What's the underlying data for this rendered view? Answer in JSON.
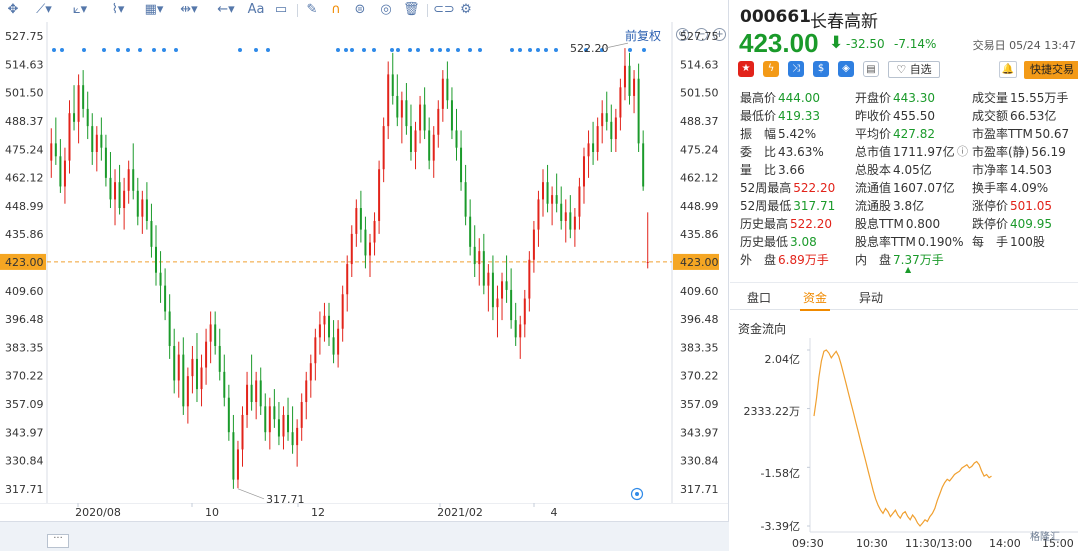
{
  "toolbar": {
    "text_tool": "Aa",
    "restore_label": "前复权"
  },
  "colors": {
    "up": "#e2231a",
    "down": "#1a9a2a",
    "price_line": "#f0a030",
    "flow_line": "#f0a030",
    "accent": "#f08a00",
    "axis_text": "#333333"
  },
  "chart_data": {
    "type": "candlestick",
    "y_ticks": [
      "527.75",
      "514.63",
      "501.50",
      "488.37",
      "475.24",
      "462.12",
      "448.99",
      "435.86",
      "423.00",
      "409.60",
      "396.48",
      "383.35",
      "370.22",
      "357.09",
      "343.97",
      "330.84",
      "317.71"
    ],
    "ylim": [
      311.15,
      534.31
    ],
    "current_price": 423.0,
    "current_price_label": "423.00",
    "high_label": "522.20",
    "low_label": "317.71",
    "x_ticks": [
      "2020/08",
      "10",
      "12",
      "2021/02",
      "4"
    ],
    "candles": [
      [
        470,
        485,
        462,
        478
      ],
      [
        478,
        490,
        468,
        472
      ],
      [
        472,
        480,
        455,
        458
      ],
      [
        458,
        476,
        450,
        470
      ],
      [
        470,
        498,
        464,
        492
      ],
      [
        492,
        505,
        484,
        488
      ],
      [
        488,
        510,
        478,
        505
      ],
      [
        505,
        512,
        490,
        494
      ],
      [
        494,
        502,
        480,
        486
      ],
      [
        486,
        492,
        468,
        474
      ],
      [
        474,
        486,
        465,
        482
      ],
      [
        482,
        490,
        470,
        476
      ],
      [
        476,
        482,
        458,
        462
      ],
      [
        462,
        474,
        448,
        452
      ],
      [
        452,
        466,
        440,
        460
      ],
      [
        460,
        468,
        445,
        448
      ],
      [
        448,
        462,
        438,
        456
      ],
      [
        456,
        470,
        450,
        466
      ],
      [
        466,
        478,
        452,
        456
      ],
      [
        456,
        462,
        440,
        444
      ],
      [
        444,
        456,
        436,
        452
      ],
      [
        452,
        460,
        438,
        442
      ],
      [
        442,
        450,
        425,
        430
      ],
      [
        430,
        440,
        412,
        418
      ],
      [
        418,
        428,
        404,
        412
      ],
      [
        412,
        420,
        396,
        400
      ],
      [
        400,
        408,
        378,
        384
      ],
      [
        384,
        392,
        362,
        368
      ],
      [
        368,
        386,
        360,
        380
      ],
      [
        380,
        388,
        352,
        356
      ],
      [
        356,
        374,
        348,
        370
      ],
      [
        370,
        384,
        362,
        378
      ],
      [
        378,
        390,
        358,
        364
      ],
      [
        364,
        380,
        356,
        374
      ],
      [
        374,
        392,
        366,
        386
      ],
      [
        386,
        400,
        376,
        394
      ],
      [
        394,
        400,
        380,
        384
      ],
      [
        384,
        392,
        368,
        372
      ],
      [
        372,
        380,
        356,
        360
      ],
      [
        360,
        366,
        340,
        344
      ],
      [
        344,
        352,
        317.71,
        322
      ],
      [
        322,
        340,
        318,
        336
      ],
      [
        336,
        356,
        328,
        352
      ],
      [
        352,
        372,
        346,
        366
      ],
      [
        366,
        380,
        354,
        358
      ],
      [
        358,
        372,
        350,
        368
      ],
      [
        368,
        374,
        352,
        356
      ],
      [
        356,
        362,
        340,
        344
      ],
      [
        344,
        360,
        336,
        356
      ],
      [
        356,
        364,
        346,
        350
      ],
      [
        350,
        358,
        338,
        342
      ],
      [
        342,
        356,
        336,
        352
      ],
      [
        352,
        360,
        340,
        344
      ],
      [
        344,
        356,
        334,
        338
      ],
      [
        338,
        350,
        328,
        346
      ],
      [
        346,
        362,
        340,
        358
      ],
      [
        358,
        372,
        350,
        368
      ],
      [
        368,
        380,
        360,
        376
      ],
      [
        376,
        392,
        368,
        388
      ],
      [
        388,
        400,
        380,
        394
      ],
      [
        394,
        404,
        386,
        398
      ],
      [
        398,
        404,
        384,
        388
      ],
      [
        388,
        396,
        376,
        380
      ],
      [
        380,
        396,
        374,
        392
      ],
      [
        392,
        412,
        386,
        408
      ],
      [
        408,
        426,
        400,
        422
      ],
      [
        422,
        440,
        416,
        436
      ],
      [
        436,
        452,
        430,
        448
      ],
      [
        448,
        456,
        432,
        438
      ],
      [
        438,
        444,
        420,
        426
      ],
      [
        426,
        436,
        416,
        432
      ],
      [
        432,
        446,
        426,
        442
      ],
      [
        442,
        470,
        436,
        466
      ],
      [
        466,
        490,
        460,
        486
      ],
      [
        486,
        516,
        480,
        510
      ],
      [
        510,
        520,
        496,
        500
      ],
      [
        500,
        510,
        486,
        490
      ],
      [
        490,
        502,
        478,
        498
      ],
      [
        498,
        506,
        482,
        486
      ],
      [
        486,
        496,
        470,
        474
      ],
      [
        474,
        488,
        466,
        484
      ],
      [
        484,
        500,
        478,
        496
      ],
      [
        496,
        504,
        480,
        484
      ],
      [
        484,
        490,
        466,
        470
      ],
      [
        470,
        486,
        462,
        482
      ],
      [
        482,
        498,
        476,
        494
      ],
      [
        494,
        512,
        488,
        508
      ],
      [
        508,
        516,
        494,
        498
      ],
      [
        498,
        504,
        480,
        484
      ],
      [
        484,
        494,
        470,
        476
      ],
      [
        476,
        484,
        456,
        460
      ],
      [
        460,
        468,
        440,
        444
      ],
      [
        444,
        452,
        426,
        430
      ],
      [
        430,
        440,
        416,
        422
      ],
      [
        422,
        434,
        412,
        428
      ],
      [
        428,
        436,
        408,
        412
      ],
      [
        412,
        422,
        400,
        418
      ],
      [
        418,
        426,
        396,
        402
      ],
      [
        402,
        412,
        388,
        406
      ],
      [
        406,
        418,
        396,
        414
      ],
      [
        414,
        426,
        404,
        410
      ],
      [
        410,
        420,
        392,
        396
      ],
      [
        396,
        404,
        384,
        388
      ],
      [
        388,
        398,
        378,
        394
      ],
      [
        394,
        410,
        388,
        406
      ],
      [
        406,
        428,
        400,
        424
      ],
      [
        424,
        442,
        418,
        438
      ],
      [
        438,
        456,
        430,
        452
      ],
      [
        452,
        466,
        444,
        460
      ],
      [
        460,
        468,
        446,
        450
      ],
      [
        450,
        458,
        440,
        454
      ],
      [
        454,
        464,
        446,
        450
      ],
      [
        450,
        458,
        438,
        442
      ],
      [
        442,
        452,
        432,
        446
      ],
      [
        446,
        454,
        434,
        438
      ],
      [
        438,
        448,
        430,
        444
      ],
      [
        444,
        462,
        438,
        458
      ],
      [
        458,
        476,
        450,
        472
      ],
      [
        472,
        484,
        462,
        478
      ],
      [
        478,
        488,
        468,
        474
      ],
      [
        474,
        490,
        470,
        486
      ],
      [
        486,
        498,
        478,
        492
      ],
      [
        492,
        502,
        484,
        488
      ],
      [
        488,
        496,
        474,
        480
      ],
      [
        480,
        494,
        474,
        490
      ],
      [
        490,
        508,
        484,
        504
      ],
      [
        504,
        522.2,
        498,
        514
      ],
      [
        514,
        520,
        496,
        500
      ],
      [
        500,
        512,
        492,
        508
      ],
      [
        508,
        515,
        474,
        478
      ],
      [
        478,
        484,
        456,
        458
      ],
      [
        423,
        446,
        420,
        423
      ]
    ]
  },
  "quote": {
    "code": "000661",
    "name": "长春高新",
    "price": "423.00",
    "change": "-32.50",
    "change_pct": "-7.14%",
    "trade_time": "交易日 05/24 13:47",
    "watch_label": "自选",
    "quick_trade_label": "快捷交易",
    "icon_names": [
      "cn-flag-icon",
      "lightning-icon",
      "shuffle-icon",
      "dollar-icon",
      "tag-icon",
      "document-icon"
    ]
  },
  "stats": [
    [
      {
        "l": "最高价",
        "v": "444.00",
        "c": "green"
      },
      {
        "l": "开盘价",
        "v": "443.30",
        "c": "green"
      },
      {
        "l": "成交量",
        "v": "15.55万手",
        "c": "dark"
      }
    ],
    [
      {
        "l": "最低价",
        "v": "419.33",
        "c": "green"
      },
      {
        "l": "昨收价",
        "v": "455.50",
        "c": "dark"
      },
      {
        "l": "成交额",
        "v": "66.53亿",
        "c": "dark"
      }
    ],
    [
      {
        "l": "振　幅",
        "v": "5.42%",
        "c": "dark"
      },
      {
        "l": "平均价",
        "v": "427.82",
        "c": "green"
      },
      {
        "l": "市盈率TTM",
        "v": "50.67",
        "c": "dark"
      }
    ],
    [
      {
        "l": "委　比",
        "v": "43.63%",
        "c": "dark"
      },
      {
        "l": "总市值",
        "v": "1711.97亿",
        "c": "dark"
      },
      {
        "l": "市盈率(静)",
        "v": "56.19",
        "c": "dark"
      }
    ],
    [
      {
        "l": "量　比",
        "v": "3.66",
        "c": "dark"
      },
      {
        "l": "总股本",
        "v": "4.05亿",
        "c": "dark"
      },
      {
        "l": "市净率",
        "v": "14.503",
        "c": "dark"
      }
    ],
    [
      {
        "l": "52周最高",
        "v": "522.20",
        "c": "red"
      },
      {
        "l": "流通值",
        "v": "1607.07亿",
        "c": "dark"
      },
      {
        "l": "换手率",
        "v": "4.09%",
        "c": "dark"
      }
    ],
    [
      {
        "l": "52周最低",
        "v": "317.71",
        "c": "green"
      },
      {
        "l": "流通股",
        "v": "3.8亿",
        "c": "dark"
      },
      {
        "l": "涨停价",
        "v": "501.05",
        "c": "red"
      }
    ],
    [
      {
        "l": "历史最高",
        "v": "522.20",
        "c": "red"
      },
      {
        "l": "股息TTM",
        "v": "0.800",
        "c": "dark"
      },
      {
        "l": "跌停价",
        "v": "409.95",
        "c": "green"
      }
    ],
    [
      {
        "l": "历史最低",
        "v": "3.08",
        "c": "green"
      },
      {
        "l": "股息率TTM",
        "v": "0.190%",
        "c": "dark"
      },
      {
        "l": "每　手",
        "v": "100股",
        "c": "dark"
      }
    ],
    [
      {
        "l": "外　盘",
        "v": "6.89万手",
        "c": "red"
      },
      {
        "l": "内　盘",
        "v": "7.37万手",
        "c": "green"
      },
      {
        "l": "",
        "v": "",
        "c": "dark"
      }
    ]
  ],
  "tabs": [
    "盘口",
    "资金",
    "异动"
  ],
  "active_tab": 1,
  "flow": {
    "title": "资金流向",
    "y_labels": [
      "2.04亿",
      "2333.22万",
      "-1.58亿",
      "-3.39亿"
    ],
    "x_labels": [
      "09:30",
      "10:30",
      "11:30/13:00",
      "14:00",
      "15:00"
    ],
    "points": [
      0,
      0.55,
      1.2,
      1.7,
      2.0,
      2.04,
      1.95,
      1.8,
      1.9,
      2.0,
      1.85,
      1.6,
      1.3,
      1.0,
      0.7,
      0.4,
      0.1,
      -0.2,
      -0.5,
      -0.8,
      -1.1,
      -1.4,
      -1.7,
      -2.0,
      -2.3,
      -2.55,
      -2.75,
      -2.9,
      -3.0,
      -2.85,
      -2.95,
      -3.1,
      -3.0,
      -2.9,
      -3.05,
      -3.15,
      -3.0,
      -2.95,
      -3.1,
      -3.2,
      -3.05,
      -3.15,
      -3.3,
      -3.39,
      -3.3,
      -3.2,
      -3.25,
      -3.1,
      -3.0,
      -2.85,
      -2.6,
      -2.4,
      -2.2,
      -2.05,
      -1.95,
      -2.0,
      -1.9,
      -1.8,
      -1.75,
      -1.7,
      -1.6,
      -1.55,
      -1.5,
      -1.6,
      -1.55,
      -1.45,
      -1.4,
      -1.5,
      -1.7,
      -1.85,
      -1.8,
      -1.9,
      -1.85
    ]
  },
  "watermark": "格隆汇"
}
